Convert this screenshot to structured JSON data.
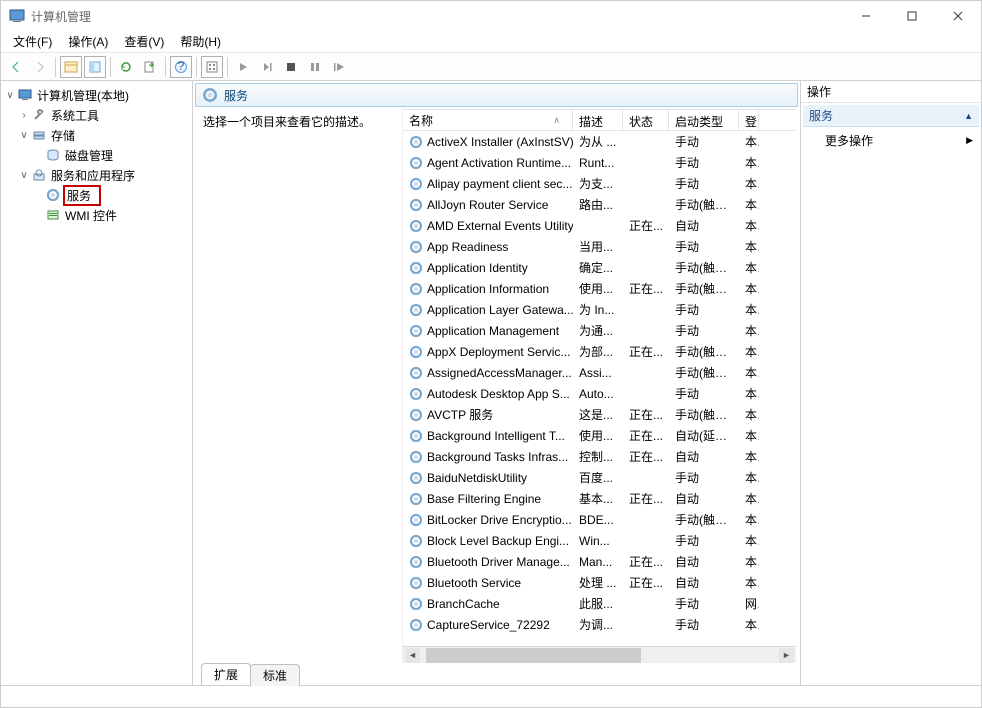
{
  "window": {
    "title": "计算机管理"
  },
  "menu": {
    "file": "文件(F)",
    "action": "操作(A)",
    "view": "查看(V)",
    "help": "帮助(H)"
  },
  "tree": {
    "root": "计算机管理(本地)",
    "sys_tools": "系统工具",
    "storage": "存储",
    "disk_mgmt": "磁盘管理",
    "svc_apps": "服务和应用程序",
    "services": "服务",
    "wmi": "WMI 控件"
  },
  "list": {
    "title": "服务",
    "desc_prompt": "选择一个项目来查看它的描述。",
    "columns": {
      "name": "名称",
      "desc": "描述",
      "status": "状态",
      "startup": "启动类型",
      "logon": "登"
    },
    "tabs": {
      "extended": "扩展",
      "standard": "标准"
    },
    "rows": [
      {
        "name": "ActiveX Installer (AxInstSV)",
        "desc": "为从 ...",
        "status": "",
        "startup": "手动",
        "logon": "本"
      },
      {
        "name": "Agent Activation Runtime...",
        "desc": "Runt...",
        "status": "",
        "startup": "手动",
        "logon": "本"
      },
      {
        "name": "Alipay payment client sec...",
        "desc": "为支...",
        "status": "",
        "startup": "手动",
        "logon": "本"
      },
      {
        "name": "AllJoyn Router Service",
        "desc": "路由...",
        "status": "",
        "startup": "手动(触发...",
        "logon": "本"
      },
      {
        "name": "AMD External Events Utility",
        "desc": "",
        "status": "正在...",
        "startup": "自动",
        "logon": "本"
      },
      {
        "name": "App Readiness",
        "desc": "当用...",
        "status": "",
        "startup": "手动",
        "logon": "本"
      },
      {
        "name": "Application Identity",
        "desc": "确定...",
        "status": "",
        "startup": "手动(触发...",
        "logon": "本"
      },
      {
        "name": "Application Information",
        "desc": "使用...",
        "status": "正在...",
        "startup": "手动(触发...",
        "logon": "本"
      },
      {
        "name": "Application Layer Gatewa...",
        "desc": "为 In...",
        "status": "",
        "startup": "手动",
        "logon": "本"
      },
      {
        "name": "Application Management",
        "desc": "为通...",
        "status": "",
        "startup": "手动",
        "logon": "本"
      },
      {
        "name": "AppX Deployment Servic...",
        "desc": "为部...",
        "status": "正在...",
        "startup": "手动(触发...",
        "logon": "本"
      },
      {
        "name": "AssignedAccessManager...",
        "desc": "Assi...",
        "status": "",
        "startup": "手动(触发...",
        "logon": "本"
      },
      {
        "name": "Autodesk Desktop App S...",
        "desc": "Auto...",
        "status": "",
        "startup": "手动",
        "logon": "本"
      },
      {
        "name": "AVCTP 服务",
        "desc": "这是...",
        "status": "正在...",
        "startup": "手动(触发...",
        "logon": "本"
      },
      {
        "name": "Background Intelligent T...",
        "desc": "使用...",
        "status": "正在...",
        "startup": "自动(延迟...",
        "logon": "本"
      },
      {
        "name": "Background Tasks Infras...",
        "desc": "控制...",
        "status": "正在...",
        "startup": "自动",
        "logon": "本"
      },
      {
        "name": "BaiduNetdiskUtility",
        "desc": "百度...",
        "status": "",
        "startup": "手动",
        "logon": "本"
      },
      {
        "name": "Base Filtering Engine",
        "desc": "基本...",
        "status": "正在...",
        "startup": "自动",
        "logon": "本"
      },
      {
        "name": "BitLocker Drive Encryptio...",
        "desc": "BDE...",
        "status": "",
        "startup": "手动(触发...",
        "logon": "本"
      },
      {
        "name": "Block Level Backup Engi...",
        "desc": "Win...",
        "status": "",
        "startup": "手动",
        "logon": "本"
      },
      {
        "name": "Bluetooth Driver Manage...",
        "desc": "Man...",
        "status": "正在...",
        "startup": "自动",
        "logon": "本"
      },
      {
        "name": "Bluetooth Service",
        "desc": "处理 ...",
        "status": "正在...",
        "startup": "自动",
        "logon": "本"
      },
      {
        "name": "BranchCache",
        "desc": "此服...",
        "status": "",
        "startup": "手动",
        "logon": "网"
      },
      {
        "name": "CaptureService_72292",
        "desc": "为调...",
        "status": "",
        "startup": "手动",
        "logon": "本"
      }
    ]
  },
  "actions": {
    "header": "操作",
    "section": "服务",
    "more": "更多操作"
  }
}
